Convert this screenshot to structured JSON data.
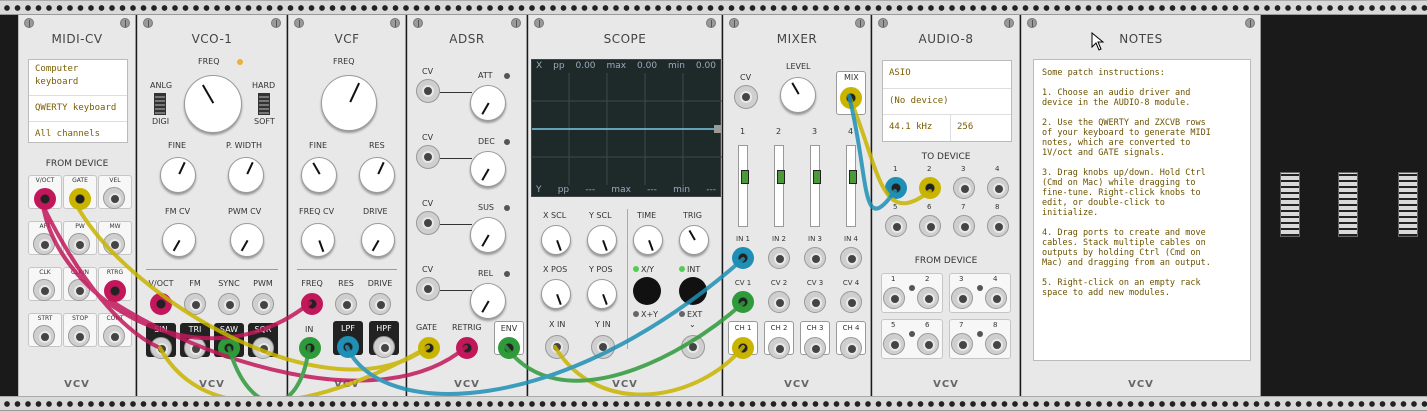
{
  "modules": {
    "midi_cv": {
      "title": "MIDI-CV",
      "lcd": [
        "Computer keyboard",
        "QWERTY keyboard",
        "All channels"
      ],
      "section": "FROM DEVICE",
      "jacks": [
        "V/OCT",
        "GATE",
        "VEL",
        "AFT",
        "PW",
        "MW",
        "CLK",
        "CLK/N",
        "RTRG",
        "STRT",
        "STOP",
        "CONT"
      ],
      "brand": "VCV"
    },
    "vco1": {
      "title": "VCO-1",
      "freq": "FREQ",
      "anlg": "ANLG",
      "digi": "DIGI",
      "hard": "HARD",
      "soft": "SOFT",
      "fine": "FINE",
      "pwidth": "P. WIDTH",
      "fmcv": "FM CV",
      "pwmcv": "PWM CV",
      "inputs": [
        "V/OCT",
        "FM",
        "SYNC",
        "PWM"
      ],
      "outputs": [
        "SIN",
        "TRI",
        "SAW",
        "SQR"
      ],
      "brand": "VCV"
    },
    "vcf": {
      "title": "VCF",
      "freq": "FREQ",
      "fine": "FINE",
      "res": "RES",
      "freqcv": "FREQ CV",
      "drive": "DRIVE",
      "inputs": [
        "FREQ",
        "RES",
        "DRIVE"
      ],
      "in": "IN",
      "lpf": "LPF",
      "hpf": "HPF",
      "brand": "VCV"
    },
    "adsr": {
      "title": "ADSR",
      "cv": "CV",
      "att": "ATT",
      "dec": "DEC",
      "sus": "SUS",
      "rel": "REL",
      "gate": "GATE",
      "retrig": "RETRIG",
      "env": "ENV",
      "brand": "VCV"
    },
    "scope": {
      "title": "SCOPE",
      "top": [
        "X",
        "pp",
        "0.00",
        "max",
        "0.00",
        "min",
        "0.00"
      ],
      "bottom": [
        "Y",
        "pp",
        "---",
        "max",
        "---",
        "min",
        "---"
      ],
      "xscl": "X SCL",
      "yscl": "Y SCL",
      "time": "TIME",
      "trig": "TRIG",
      "xpos": "X POS",
      "ypos": "Y POS",
      "xy": "X/Y",
      "xplusy": "X+Y",
      "int": "INT",
      "ext": "EXT",
      "xin": "X IN",
      "yin": "Y IN",
      "brand": "VCV"
    },
    "mixer": {
      "title": "MIXER",
      "cv": "CV",
      "level": "LEVEL",
      "mix": "MIX",
      "channels": [
        "1",
        "2",
        "3",
        "4"
      ],
      "ins": [
        "IN 1",
        "IN 2",
        "IN 3",
        "IN 4"
      ],
      "cvs": [
        "CV 1",
        "CV 2",
        "CV 3",
        "CV 4"
      ],
      "chs": [
        "CH 1",
        "CH 2",
        "CH 3",
        "CH 4"
      ],
      "brand": "VCV"
    },
    "audio8": {
      "title": "AUDIO-8",
      "driver": "ASIO",
      "device": "(No device)",
      "rate": "44.1 kHz",
      "block": "256",
      "to_device": "TO DEVICE",
      "from_device": "FROM DEVICE",
      "ports": [
        "1",
        "2",
        "3",
        "4",
        "5",
        "6",
        "7",
        "8"
      ],
      "brand": "VCV"
    },
    "notes": {
      "title": "NOTES",
      "text": "Some patch instructions:\n\n1. Choose an audio driver and\ndevice in the AUDIO-8 module.\n\n2. Use the QWERTY and ZXCVB rows\nof your keyboard to generate MIDI\nnotes, which are converted to\n1V/oct and GATE signals.\n\n3. Drag knobs up/down. Hold Ctrl\n(Cmd on Mac) while dragging to\nfine-tune. Right-click knobs to\nedit, or double-click to\ninitialize.\n\n4. Drag ports to create and move\ncables. Stack multiple cables on\noutputs by holding Ctrl (Cmd on\nMac) and dragging from an output.\n\n5. Right-click on an empty rack\nspace to add new modules.",
      "brand": "VCV"
    }
  },
  "colors": {
    "red": "#c2185b",
    "yellow": "#c9b400",
    "green": "#2e9a3a",
    "blue": "#1f8fb5"
  },
  "icons": [
    "screw-icon",
    "cursor-icon"
  ]
}
